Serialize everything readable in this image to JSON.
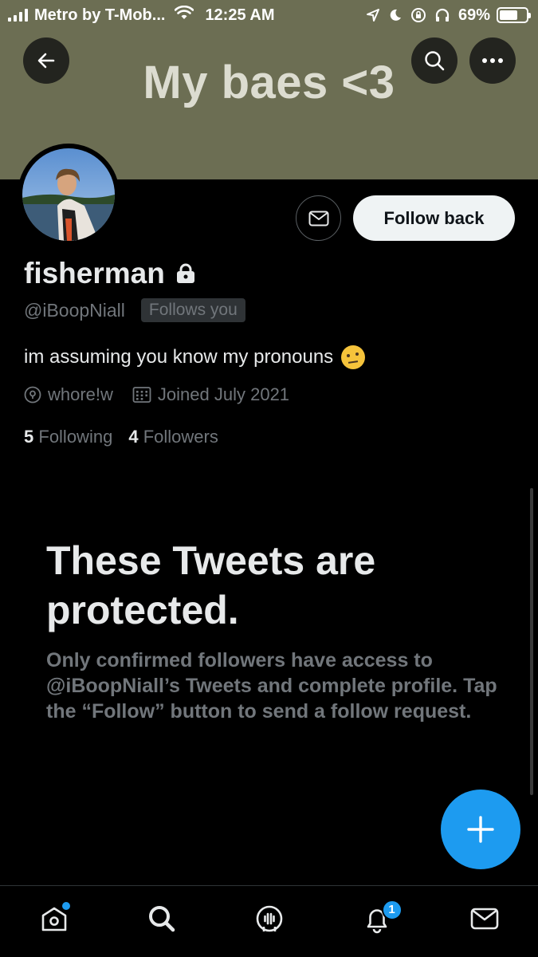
{
  "status_bar": {
    "carrier": "Metro by T-Mob...",
    "time": "12:25 AM",
    "battery_percent": "69%",
    "battery_level": 0.69,
    "icons": [
      "signal-icon",
      "wifi-icon",
      "location-icon",
      "moon-icon",
      "rotation-lock-icon",
      "headphones-icon",
      "battery-icon"
    ]
  },
  "header": {
    "banner_text": "My baes <3",
    "banner_color": "#6c6e53",
    "back_icon": "arrow-left-icon",
    "search_icon": "search-icon",
    "more_icon": "more-icon"
  },
  "profile": {
    "display_name": "fisherman",
    "protected_icon": "lock-icon",
    "handle": "@iBoopNiall",
    "follows_you_label": "Follows you",
    "bio": "im assuming you know my pronouns",
    "bio_emoji": "raised-eyebrow-emoji",
    "location": "whore!w",
    "joined": "Joined July 2021",
    "following_count": "5",
    "following_label": "Following",
    "followers_count": "4",
    "followers_label": "Followers"
  },
  "actions": {
    "dm_icon": "mail-icon",
    "follow_back_label": "Follow back"
  },
  "protected": {
    "title": "These Tweets are protected.",
    "body": "Only confirmed followers have access to @iBoopNiall’s Tweets and complete profile. Tap the “Follow” button to send a follow request."
  },
  "fab": {
    "icon": "plus-icon"
  },
  "bottom_nav": {
    "items": [
      "home-icon",
      "search-icon",
      "spaces-icon",
      "notifications-icon",
      "messages-icon"
    ],
    "notification_count": "1"
  },
  "colors": {
    "accent": "#1d9bf0",
    "background": "#000000",
    "secondary_text": "#71767b"
  }
}
